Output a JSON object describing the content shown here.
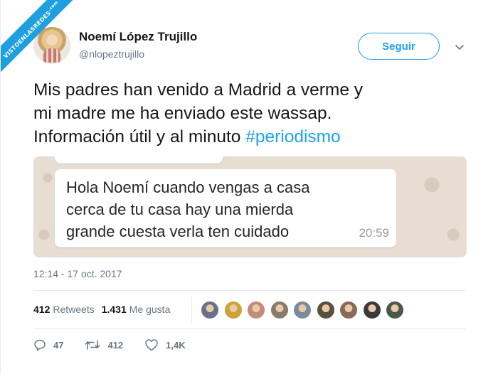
{
  "watermark": {
    "text": "VISTOENLASREDES",
    "tld": ".com"
  },
  "user": {
    "name": "Noemí López Trujillo",
    "handle": "@nlopeztrujillo",
    "avatar_icon": "avatar-photo"
  },
  "follow": {
    "label": "Seguir"
  },
  "tweet": {
    "text_lines": [
      "Mis padres han venido a Madrid a verme y",
      "mi madre me ha enviado este wassap.",
      "Información útil y al minuto "
    ],
    "hashtag": "#periodismo"
  },
  "media": {
    "message_lines": [
      "Hola Noemí cuando vengas a casa",
      "cerca de tu casa hay una mierda",
      "grande cuesta verla ten cuidado"
    ],
    "time": "20:59"
  },
  "timestamp": "12:14 - 17 oct. 2017",
  "stats": {
    "retweets_count": "412",
    "retweets_label": "Retweets",
    "likes_count": "1.431",
    "likes_label": "Me gusta",
    "liker_avatar_colors": [
      "#6a6f8a",
      "#d0a23a",
      "#c48a7a",
      "#8a7a6a",
      "#7a8c9c",
      "#5a5040",
      "#8a6a5a",
      "#3a3a3a",
      "#4a5a4a"
    ]
  },
  "actions": {
    "replies": "47",
    "retweets": "412",
    "likes": "1,4K"
  },
  "colors": {
    "accent": "#1da1f2",
    "muted": "#657786"
  }
}
